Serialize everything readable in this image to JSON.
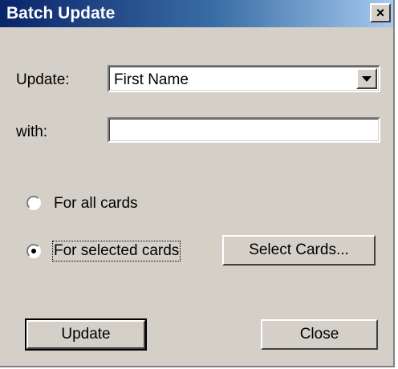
{
  "window": {
    "title": "Batch Update",
    "close_glyph": "×"
  },
  "update_field": {
    "label": "Update:",
    "value": "First Name"
  },
  "with_field": {
    "label": "with:",
    "value": ""
  },
  "scope": {
    "all_cards_label": "For all cards",
    "selected_cards_label": "For selected cards",
    "selected_option": "selected_cards"
  },
  "buttons": {
    "select_cards": "Select Cards...",
    "update": "Update",
    "close": "Close"
  },
  "colors": {
    "titlebar_start": "#0a246a",
    "titlebar_end": "#a6caf0",
    "dialog_bg": "#d4d0c8"
  }
}
